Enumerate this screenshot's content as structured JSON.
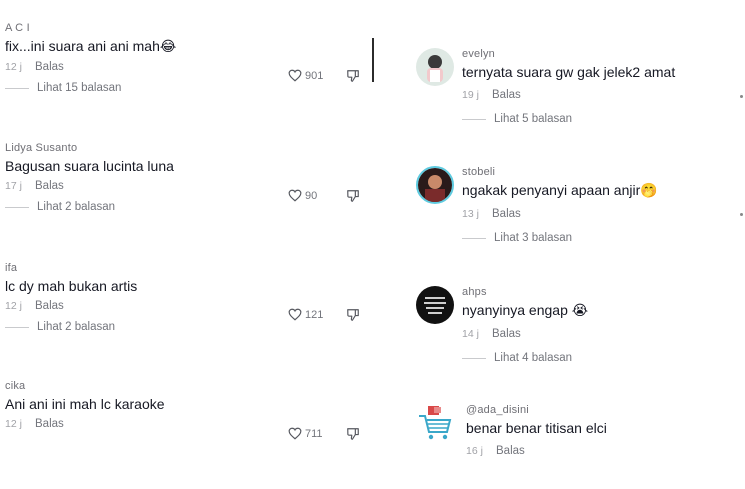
{
  "left_comments": [
    {
      "user": "A C I",
      "text": "fix...ini suara ani ani mah😂",
      "date": "12 j",
      "reply": "Balas",
      "likes": "901",
      "replies": "Lihat 15 balasan"
    },
    {
      "user": "Lidya Susanto",
      "text": "Bagusan suara lucinta luna",
      "date": "17 j",
      "reply": "Balas",
      "likes": "90",
      "replies": "Lihat 2 balasan"
    },
    {
      "user": "ifa",
      "text": "lc dy mah bukan artis",
      "date": "12 j",
      "reply": "Balas",
      "likes": "121",
      "replies": "Lihat 2 balasan"
    },
    {
      "user": "cika",
      "text": "Ani ani ini mah lc karaoke",
      "date": "12 j",
      "reply": "Balas",
      "likes": "711"
    }
  ],
  "right_comments": [
    {
      "user": "evelyn",
      "text": "ternyata suara gw gak jelek2 amat",
      "date": "19 j",
      "reply": "Balas",
      "replies": "Lihat 5 balasan"
    },
    {
      "user": "stobeli",
      "text": "ngakak penyanyi apaan anjir🤭",
      "date": "13 j",
      "reply": "Balas",
      "replies": "Lihat 3 balasan"
    },
    {
      "user": "ahps",
      "text": "nyanyinya engap 😭",
      "date": "14 j",
      "reply": "Balas",
      "replies": "Lihat 4 balasan"
    },
    {
      "user": "@ada_disini",
      "text": "benar benar titisan elci",
      "date": "16 j",
      "reply": "Balas"
    }
  ],
  "icons": {
    "like": "heart-outline-icon",
    "dislike": "thumbs-down-outline-icon"
  },
  "colors": {
    "text": "#161823",
    "muted": "#a1a2a7",
    "secondary": "#73757c"
  }
}
